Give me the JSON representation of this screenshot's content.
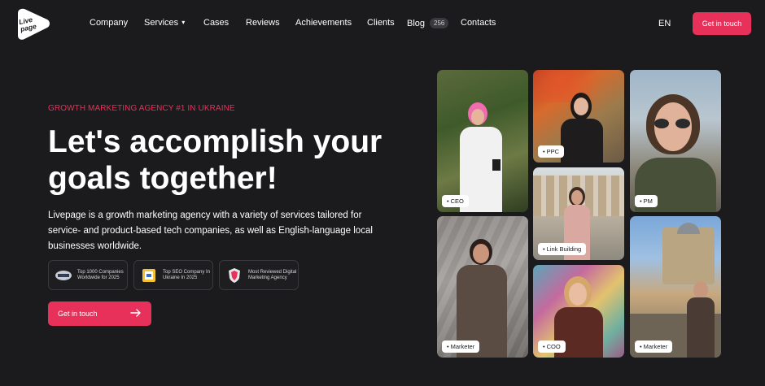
{
  "header": {
    "logo_text": "Live page",
    "nav": [
      {
        "label": "Company"
      },
      {
        "label": "Services",
        "chevron": "▾"
      },
      {
        "label": "Cases"
      },
      {
        "label": "Reviews"
      },
      {
        "label": "Achievements"
      },
      {
        "label": "Clients"
      },
      {
        "label": "Blog",
        "badge": "256"
      },
      {
        "label": "Contacts"
      }
    ],
    "language": "EN",
    "cta": "Get in touch"
  },
  "hero": {
    "eyebrow": "GROWTH MARKETING AGENCY #1 IN UKRAINE",
    "headline": "Let's accomplish your goals together!",
    "description": "Livepage is a growth marketing agency with a variety of services tailored for service- and product-based tech companies, as well as English-language local businesses worldwide.",
    "awards": [
      {
        "text": "Top 1000 Companies Worldwide for 2025",
        "icon": "clutch-badge-icon"
      },
      {
        "text": "Top SEO Company In Ukraine In 2025",
        "icon": "award-badge-icon"
      },
      {
        "text": "Most Reviewed Digital Marketing Agency",
        "icon": "shield-badge-icon"
      }
    ],
    "cta": "Get in touch"
  },
  "team": {
    "photos": [
      {
        "role": "CEO"
      },
      {
        "role": "PPC"
      },
      {
        "role": "PM"
      },
      {
        "role": "Link Building"
      },
      {
        "role": "Marketer"
      },
      {
        "role": "COO"
      },
      {
        "role": "Marketer"
      }
    ]
  },
  "colors": {
    "background": "#1b1a1d",
    "accent": "#e8315a"
  }
}
